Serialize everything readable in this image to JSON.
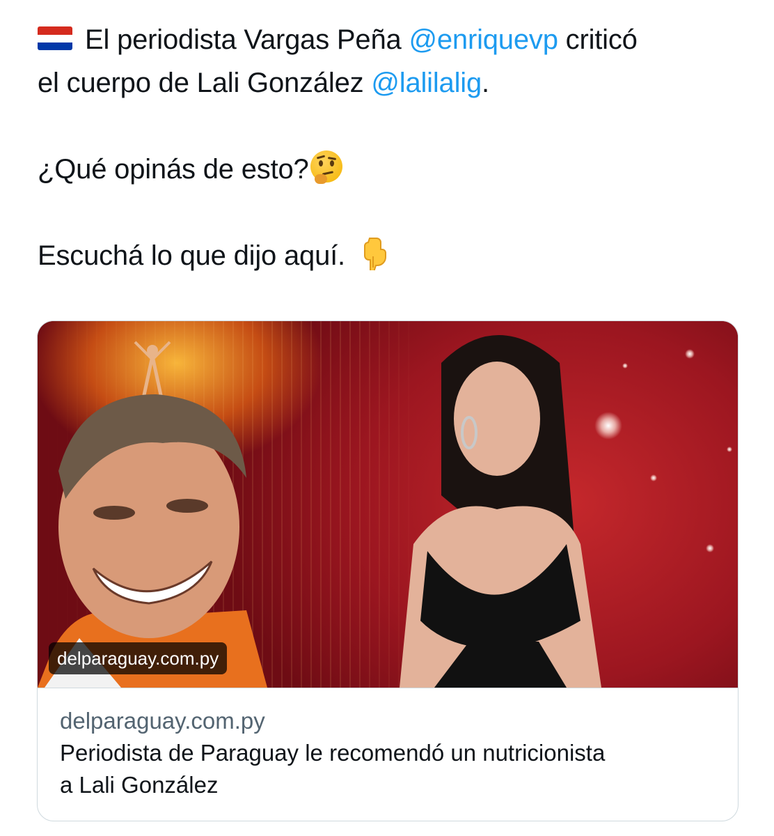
{
  "tweet": {
    "text_line1_before": "El periodista Vargas Peña ",
    "mention1": "@enriquevp",
    "text_line1_after": " criticó",
    "text_line2_before": "el cuerpo de Lali González ",
    "mention2": "@lalilalig",
    "text_line2_after": ".",
    "question": "¿Qué opinás de esto?",
    "listen": "Escuchá lo que dijo aquí.",
    "flag_icon": "paraguay-flag-icon",
    "thinking_icon": "thinking-face-icon",
    "pointing_icon": "pointing-down-icon",
    "colors": {
      "mention": "#1d9bf0",
      "text": "#0f1419"
    }
  },
  "card": {
    "image_badge": "delparaguay.com.py",
    "domain": "delparaguay.com.py",
    "title": "Periodista de Paraguay le recomendó un nutricionista a Lali González",
    "colors": {
      "domain": "#536471",
      "border": "#cfd9de"
    }
  }
}
